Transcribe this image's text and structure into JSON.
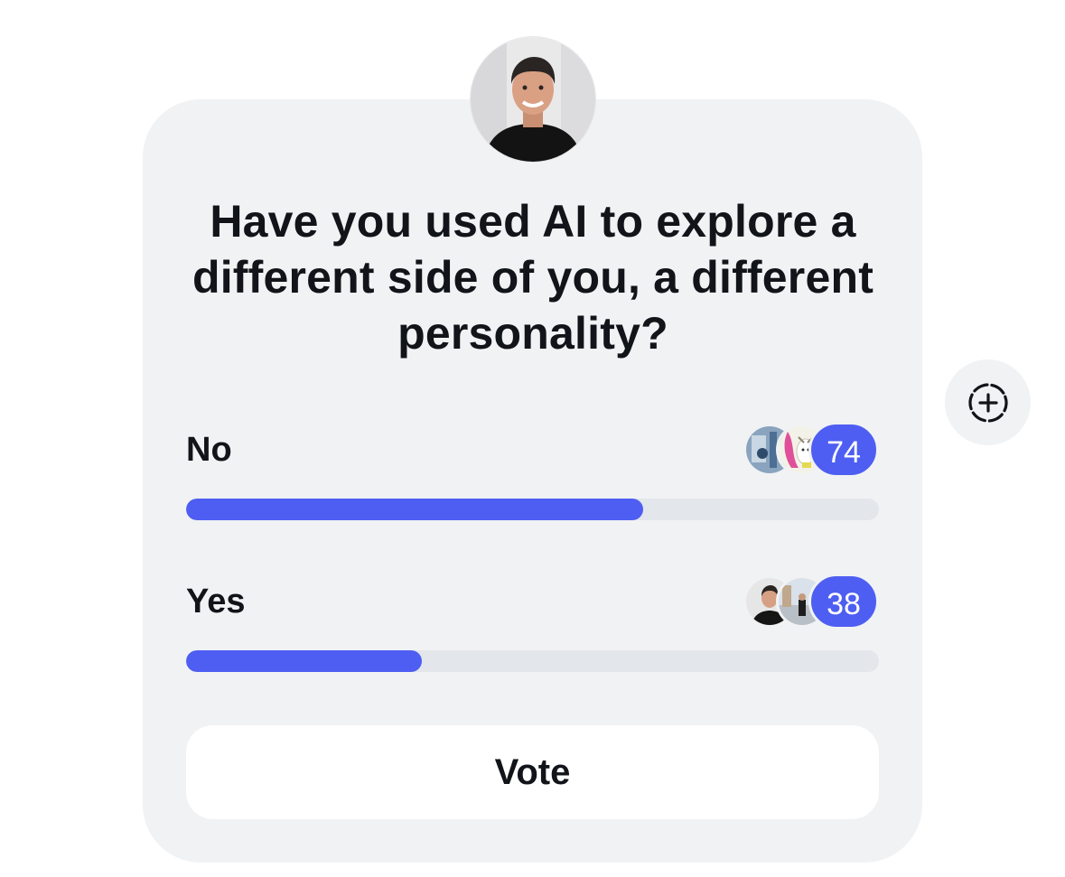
{
  "poll": {
    "question": "Have you used AI to explore a different side of you, a different personality?",
    "author_avatar_icon": "person-avatar",
    "options": [
      {
        "label": "No",
        "count": "74",
        "share": 0.66,
        "voter_icons": [
          "abstract-avatar",
          "cartoon-avatar"
        ]
      },
      {
        "label": "Yes",
        "count": "38",
        "share": 0.34,
        "voter_icons": [
          "person-avatar",
          "street-photo-avatar"
        ]
      }
    ],
    "vote_label": "Vote",
    "add_reaction_icon": "dashed-plus-circle-icon"
  },
  "colors": {
    "accent": "#4e5ef2",
    "card": "#f1f2f4",
    "track": "#e3e6ea"
  }
}
